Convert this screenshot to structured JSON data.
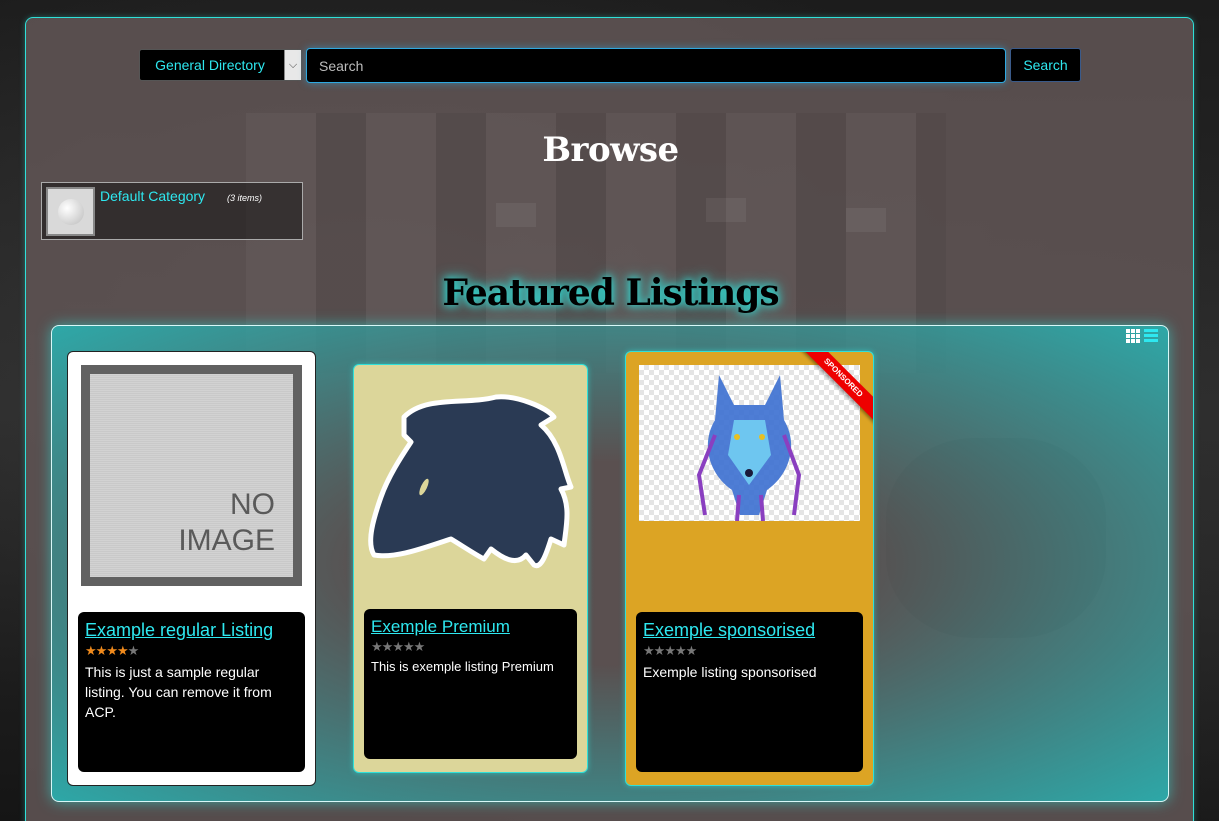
{
  "search": {
    "directory_label": "General Directory",
    "placeholder": "Search",
    "button_label": "Search"
  },
  "browse": {
    "title": "Browse",
    "category": {
      "name": "Default Category",
      "count": "(3 items)"
    }
  },
  "featured": {
    "title": "Featured Listings",
    "view_icons": [
      "grid-view-icon",
      "list-view-icon"
    ],
    "listings": [
      {
        "title": "Example regular Listing",
        "rating": 4,
        "rating_max": 5,
        "description": "This is just a sample regular listing. You can remove it from ACP.",
        "image_text": [
          "NO",
          "IMAGE"
        ]
      },
      {
        "title": "Exemple Premium",
        "rating": 0,
        "rating_max": 5,
        "description": "This is exemple listing Premium"
      },
      {
        "title": "Exemple sponsorised",
        "rating": 0,
        "rating_max": 5,
        "description": "Exemple listing sponsorised",
        "badge": "SPONSORED"
      }
    ]
  },
  "colors": {
    "accent": "#2ee8f0",
    "premium_card": "#dcd69a",
    "sponsored_card": "#dca424",
    "star_on": "#f08a1c"
  }
}
